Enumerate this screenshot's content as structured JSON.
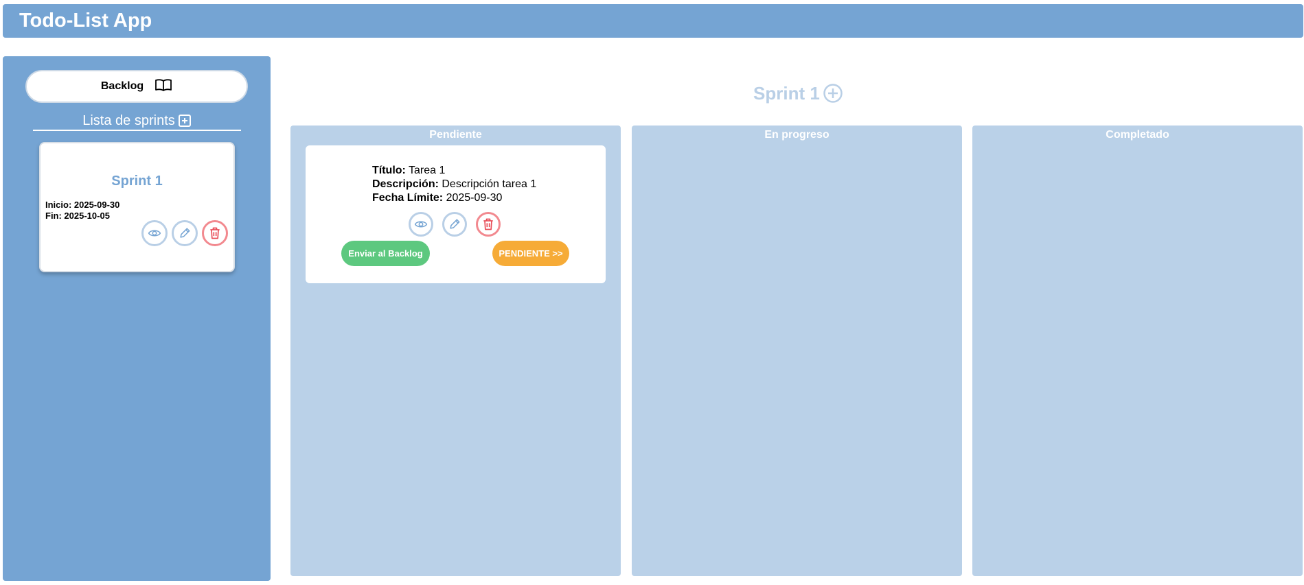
{
  "app": {
    "title": "Todo-List App"
  },
  "sidebar": {
    "backlog_label": "Backlog",
    "sprints_label": "Lista de sprints",
    "sprints": [
      {
        "title": "Sprint 1",
        "start": "Inicio: 2025-09-30",
        "end": "Fin: 2025-10-05"
      }
    ]
  },
  "main": {
    "title": "Sprint 1",
    "columns": [
      {
        "title": "Pendiente",
        "tasks": [
          {
            "title_label": "Título:",
            "title_value": " Tarea 1",
            "desc_label": "Descripción:",
            "desc_value": " Descripción tarea 1",
            "date_label": "Fecha Límite:",
            "date_value": " 2025-09-30",
            "backlog_button": "Enviar al Backlog",
            "status_button": "PENDIENTE >>"
          }
        ]
      },
      {
        "title": "En progreso",
        "tasks": []
      },
      {
        "title": "Completado",
        "tasks": []
      }
    ]
  },
  "colors": {
    "header": "#75a4d3",
    "sidebar": "#75a4d3",
    "column": "#bad1e8",
    "accent": "#75a4d3",
    "green": "#5dc87f",
    "orange": "#f6ab37",
    "red": "#e84a55"
  },
  "icons": [
    "book-icon",
    "plus-square-icon",
    "eye-icon",
    "pencil-icon",
    "trash-icon",
    "plus-circle-icon"
  ]
}
